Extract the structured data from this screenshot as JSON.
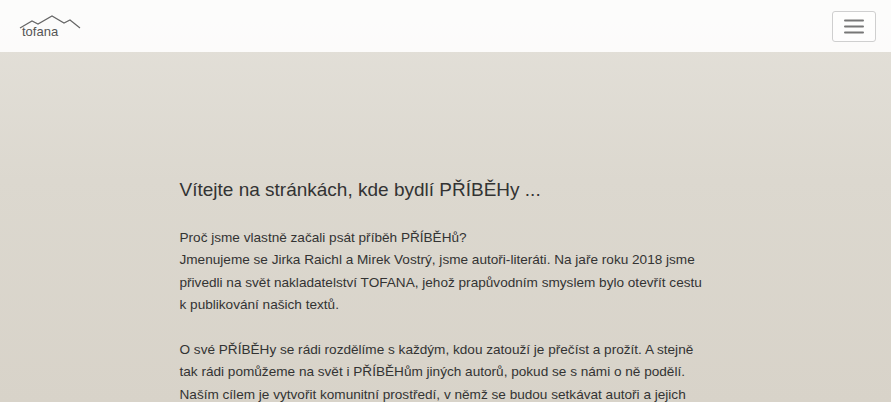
{
  "navbar": {
    "brand": "tofana"
  },
  "hero": {
    "heading": "Vítejte na stránkách, kde bydlí PŘÍBĚHy ...",
    "paragraphs": [
      {
        "lines": [
          "Proč jsme vlastně začali psát příběh PŘÍBĚHů?",
          "Jmenujeme se Jirka Raichl a Mirek Vostrý, jsme autoři-literáti. Na jaře roku 2018 jsme přivedli na svět nakladatelství TOFANA, jehož prapůvodním smyslem bylo otevřít cestu k publikování našich textů."
        ]
      },
      {
        "lines": [
          "O své PŘÍBĚHy se rádi rozdělíme s každým, kdou zatouží je přečíst a prožít. A stejně tak rádi pomůžeme na svět i PŘÍBĚHům jiných autorů, pokud se s námi o ně podělí. Naším cílem je vytvořit komunitní prostředí, v němž se budou setkávat autoři a jejich"
        ]
      }
    ]
  }
}
